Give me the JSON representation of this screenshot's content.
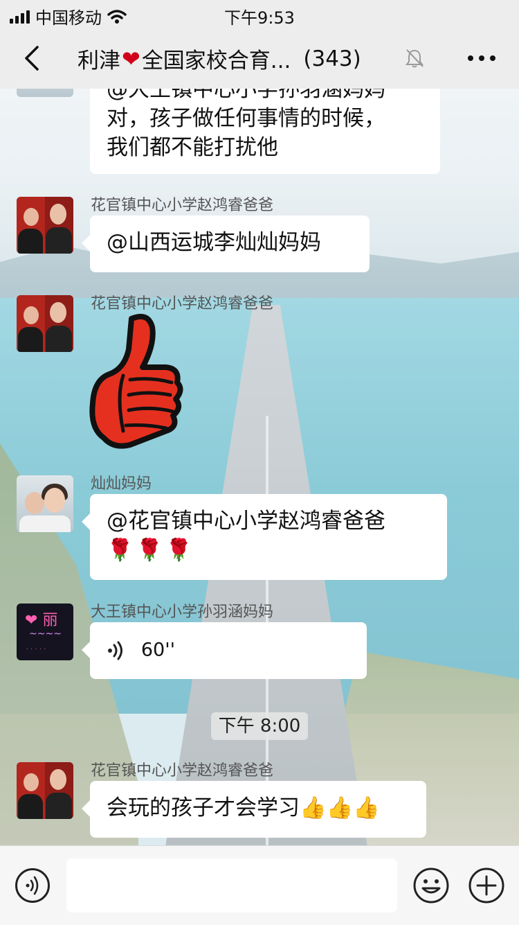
{
  "status_bar": {
    "carrier": "中国移动",
    "time": "下午9:53"
  },
  "nav": {
    "title_prefix": "利津",
    "title_suffix": "全国家校合育...",
    "member_count": "(343)"
  },
  "messages": [
    {
      "type": "text",
      "lines": [
        "@大王镇中心小学孙羽涵妈妈",
        "对，孩子做任何事情的时候，",
        "我们都不能打扰他"
      ]
    },
    {
      "type": "text",
      "sender": "花官镇中心小学赵鸿睿爸爸",
      "text": "@山西运城李灿灿妈妈"
    },
    {
      "type": "sticker",
      "sender": "花官镇中心小学赵鸿睿爸爸",
      "sticker": "thumbs-up-sticker"
    },
    {
      "type": "text",
      "sender": "灿灿妈妈",
      "text": "@花官镇中心小学赵鸿睿爸爸",
      "emoji_line": "🌹🌹🌹"
    },
    {
      "type": "voice",
      "sender": "大王镇中心小学孙羽涵妈妈",
      "duration": "60''",
      "avatar_text": "丽"
    },
    {
      "type": "timestamp",
      "text": "下午 8:00"
    },
    {
      "type": "text",
      "sender": "花官镇中心小学赵鸿睿爸爸",
      "text": "会玩的孩子才会学习👍👍👍"
    }
  ],
  "input_bar": {
    "placeholder": ""
  },
  "colors": {
    "bar_bg": "#ededed",
    "bubble_bg": "#ffffff",
    "heart": "#d0021b"
  }
}
